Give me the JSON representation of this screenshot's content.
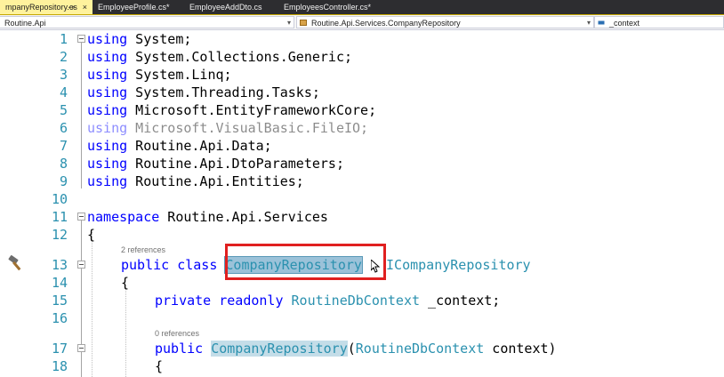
{
  "tabs": [
    {
      "label": "mpanyRepository.cs",
      "active": true
    },
    {
      "label": "EmployeeProfile.cs*",
      "active": false
    },
    {
      "label": "EmployeeAddDto.cs",
      "active": false
    },
    {
      "label": "EmployeesController.cs*",
      "active": false
    }
  ],
  "tab_pin": "⊸",
  "tab_close": "×",
  "nav": {
    "project": "Routine.Api",
    "class": "Routine.Api.Services.CompanyRepository",
    "member": "_context"
  },
  "code_lens": {
    "class_refs": "2 references",
    "ctor_refs": "0 references"
  },
  "lines": {
    "l1": {
      "num": "1",
      "kw": "using",
      "rest": " System;"
    },
    "l2": {
      "num": "2",
      "kw": "using",
      "rest": " System.Collections.Generic;"
    },
    "l3": {
      "num": "3",
      "kw": "using",
      "rest": " System.Linq;"
    },
    "l4": {
      "num": "4",
      "kw": "using",
      "rest": " System.Threading.Tasks;"
    },
    "l5": {
      "num": "5",
      "kw": "using",
      "rest": " Microsoft.EntityFrameworkCore;"
    },
    "l6": {
      "num": "6",
      "kw": "using",
      "rest": " Microsoft.VisualBasic.FileIO;"
    },
    "l7": {
      "num": "7",
      "kw": "using",
      "rest": " Routine.Api.Data;"
    },
    "l8": {
      "num": "8",
      "kw": "using",
      "rest": " Routine.Api.DtoParameters;"
    },
    "l9": {
      "num": "9",
      "kw": "using",
      "rest": " Routine.Api.Entities;"
    },
    "l10": {
      "num": "10"
    },
    "l11": {
      "num": "11",
      "kw": "namespace",
      "rest": " Routine.Api.Services"
    },
    "l12": {
      "num": "12",
      "text": "{"
    },
    "l13": {
      "num": "13",
      "kw1": "public",
      "kw2": "class",
      "name": "CompanyRepository",
      "sep": " : ",
      "iface": "ICompanyRepository"
    },
    "l14": {
      "num": "14",
      "text": "{"
    },
    "l15": {
      "num": "15",
      "kw1": "private",
      "kw2": "readonly",
      "type": "RoutineDbContext",
      "rest": " _context;"
    },
    "l16": {
      "num": "16"
    },
    "l17": {
      "num": "17",
      "kw1": "public",
      "name": "CompanyRepository",
      "open": "(",
      "type": "RoutineDbContext",
      "rest": " context)"
    },
    "l18": {
      "num": "18",
      "text": "{"
    }
  }
}
